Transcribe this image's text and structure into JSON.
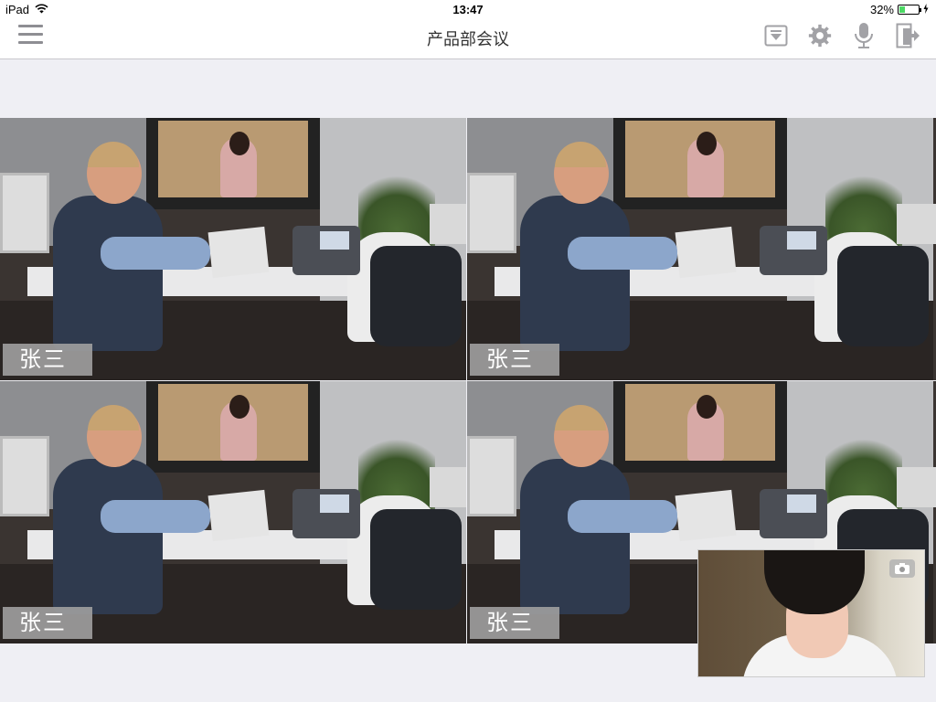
{
  "status_bar": {
    "device": "iPad",
    "time": "13:47",
    "battery": "32%",
    "battery_level": 0.32
  },
  "nav": {
    "title": "产品部会议",
    "menu_icon": "menu-icon",
    "actions": [
      {
        "name": "dropdown-icon"
      },
      {
        "name": "settings-gear-icon"
      },
      {
        "name": "microphone-icon"
      },
      {
        "name": "exit-icon"
      }
    ]
  },
  "tiles": [
    {
      "participant": "张三"
    },
    {
      "participant": "张三"
    },
    {
      "participant": "张三"
    },
    {
      "participant": "张三"
    }
  ],
  "self_view": {
    "switch_camera_icon": "camera-switch-icon"
  }
}
